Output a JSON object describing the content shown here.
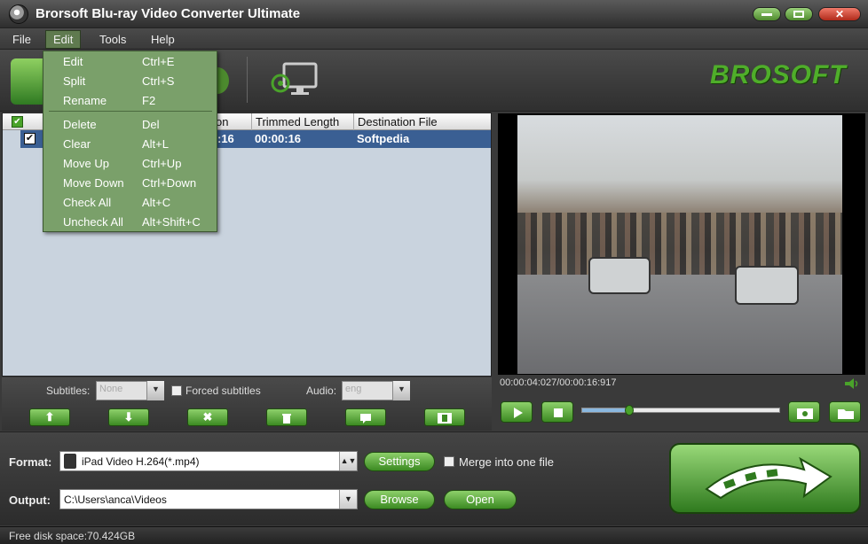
{
  "window": {
    "title": "Brorsoft Blu-ray Video Converter Ultimate",
    "brand": "BROSOFT"
  },
  "menubar": [
    {
      "label": "File"
    },
    {
      "label": "Edit"
    },
    {
      "label": "Tools"
    },
    {
      "label": "Help"
    }
  ],
  "edit_menu": [
    {
      "label": "Edit",
      "shortcut": "Ctrl+E"
    },
    {
      "label": "Split",
      "shortcut": "Ctrl+S"
    },
    {
      "label": "Rename",
      "shortcut": "F2"
    },
    {
      "label": "Delete",
      "shortcut": "Del"
    },
    {
      "label": "Clear",
      "shortcut": "Alt+L"
    },
    {
      "label": "Move Up",
      "shortcut": "Ctrl+Up"
    },
    {
      "label": "Move Down",
      "shortcut": "Ctrl+Down"
    },
    {
      "label": "Check All",
      "shortcut": "Alt+C"
    },
    {
      "label": "Uncheck All",
      "shortcut": "Alt+Shift+C"
    }
  ],
  "file_list": {
    "columns": [
      "on",
      "Trimmed Length",
      "Destination File"
    ],
    "rows": [
      {
        "duration_partial": ":16",
        "trimmed_length": "00:00:16",
        "destination": "Softpedia",
        "checked": true
      }
    ]
  },
  "subtitle_row": {
    "subtitles_label": "Subtitles:",
    "subtitles_value": "None",
    "forced_label": "Forced subtitles",
    "audio_label": "Audio:",
    "audio_value": "eng"
  },
  "list_buttons": [
    "up-arrow-icon",
    "down-arrow-icon",
    "remove-icon",
    "trash-icon",
    "comment-icon",
    "film-icon"
  ],
  "preview": {
    "timecode": "00:00:04:027/00:00:16:917",
    "progress_fraction": 0.24
  },
  "output": {
    "format_label": "Format:",
    "format_value": "iPad Video H.264(*.mp4)",
    "settings_label": "Settings",
    "merge_label": "Merge into one file",
    "output_label": "Output:",
    "output_value": "C:\\Users\\anca\\Videos",
    "browse_label": "Browse",
    "open_label": "Open"
  },
  "status": {
    "free_space": "Free disk space:70.424GB"
  },
  "colors": {
    "accent_green": "#4aa32a",
    "selection_blue": "#3a5f93",
    "menu_green": "#7aa06a"
  }
}
